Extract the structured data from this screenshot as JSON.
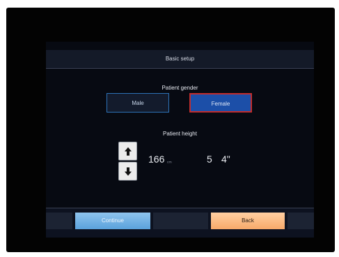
{
  "title": "Basic setup",
  "gender": {
    "label": "Patient gender",
    "options": [
      "Male",
      "Female"
    ],
    "selected": "Female"
  },
  "height": {
    "label": "Patient height",
    "cm_value": "166",
    "cm_unit": "cm",
    "feet": "5",
    "inches": "4\""
  },
  "buttons": {
    "continue": "Continue",
    "back": "Back"
  },
  "colors": {
    "selected_border": "#c22d2d",
    "continue_button": "#6aaee2",
    "back_button": "#f9b77c"
  }
}
